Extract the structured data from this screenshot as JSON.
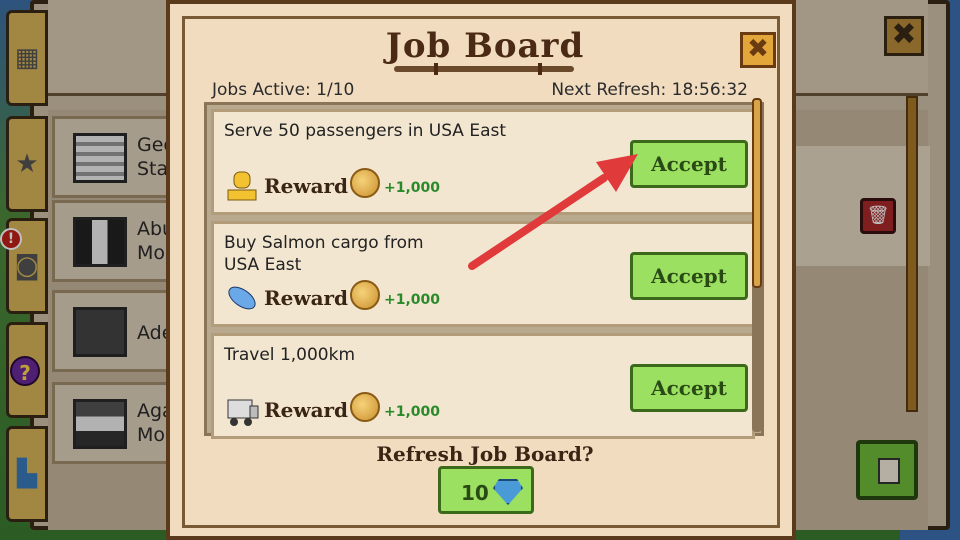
{
  "background": {
    "window_close_glyph": "✖",
    "rows": [
      {
        "label_lines": [
          "Geo",
          "Stat"
        ],
        "flag": "usa-flag-icon"
      },
      {
        "label_lines": [
          "Abu",
          "Mos"
        ],
        "flag": "flag-icon"
      },
      {
        "label_lines": [
          "Ade",
          ""
        ],
        "flag": "australia-flag-icon"
      },
      {
        "label_lines": [
          "Aga",
          "Mos"
        ],
        "flag": "flag-icon"
      }
    ],
    "side_tabs": [
      "map-icon",
      "star-icon",
      "camera-icon",
      "help-icon",
      "stats-icon"
    ]
  },
  "modal": {
    "title": "Job Board",
    "close_glyph": "✖",
    "jobs_active_label": "Jobs Active: 1/10",
    "next_refresh_label": "Next Refresh: 18:56:32",
    "jobs": [
      {
        "description": "Serve 50 passengers in USA East",
        "reward_label": "Reward",
        "reward_amount": "+1,000",
        "accept_label": "Accept",
        "reward_icon": "passenger-icon"
      },
      {
        "description": "Buy Salmon cargo from\nUSA East",
        "reward_label": "Reward",
        "reward_amount": "+1,000",
        "accept_label": "Accept",
        "reward_icon": "fish-icon"
      },
      {
        "description": "Travel 1,000km",
        "reward_label": "Reward",
        "reward_amount": "+1,000",
        "accept_label": "Accept",
        "reward_icon": "train-icon"
      }
    ],
    "refresh_question": "Refresh Job Board?",
    "refresh_cost": "10"
  },
  "colors": {
    "arrow": "#e03a3a",
    "accept_green": "#9be061"
  }
}
